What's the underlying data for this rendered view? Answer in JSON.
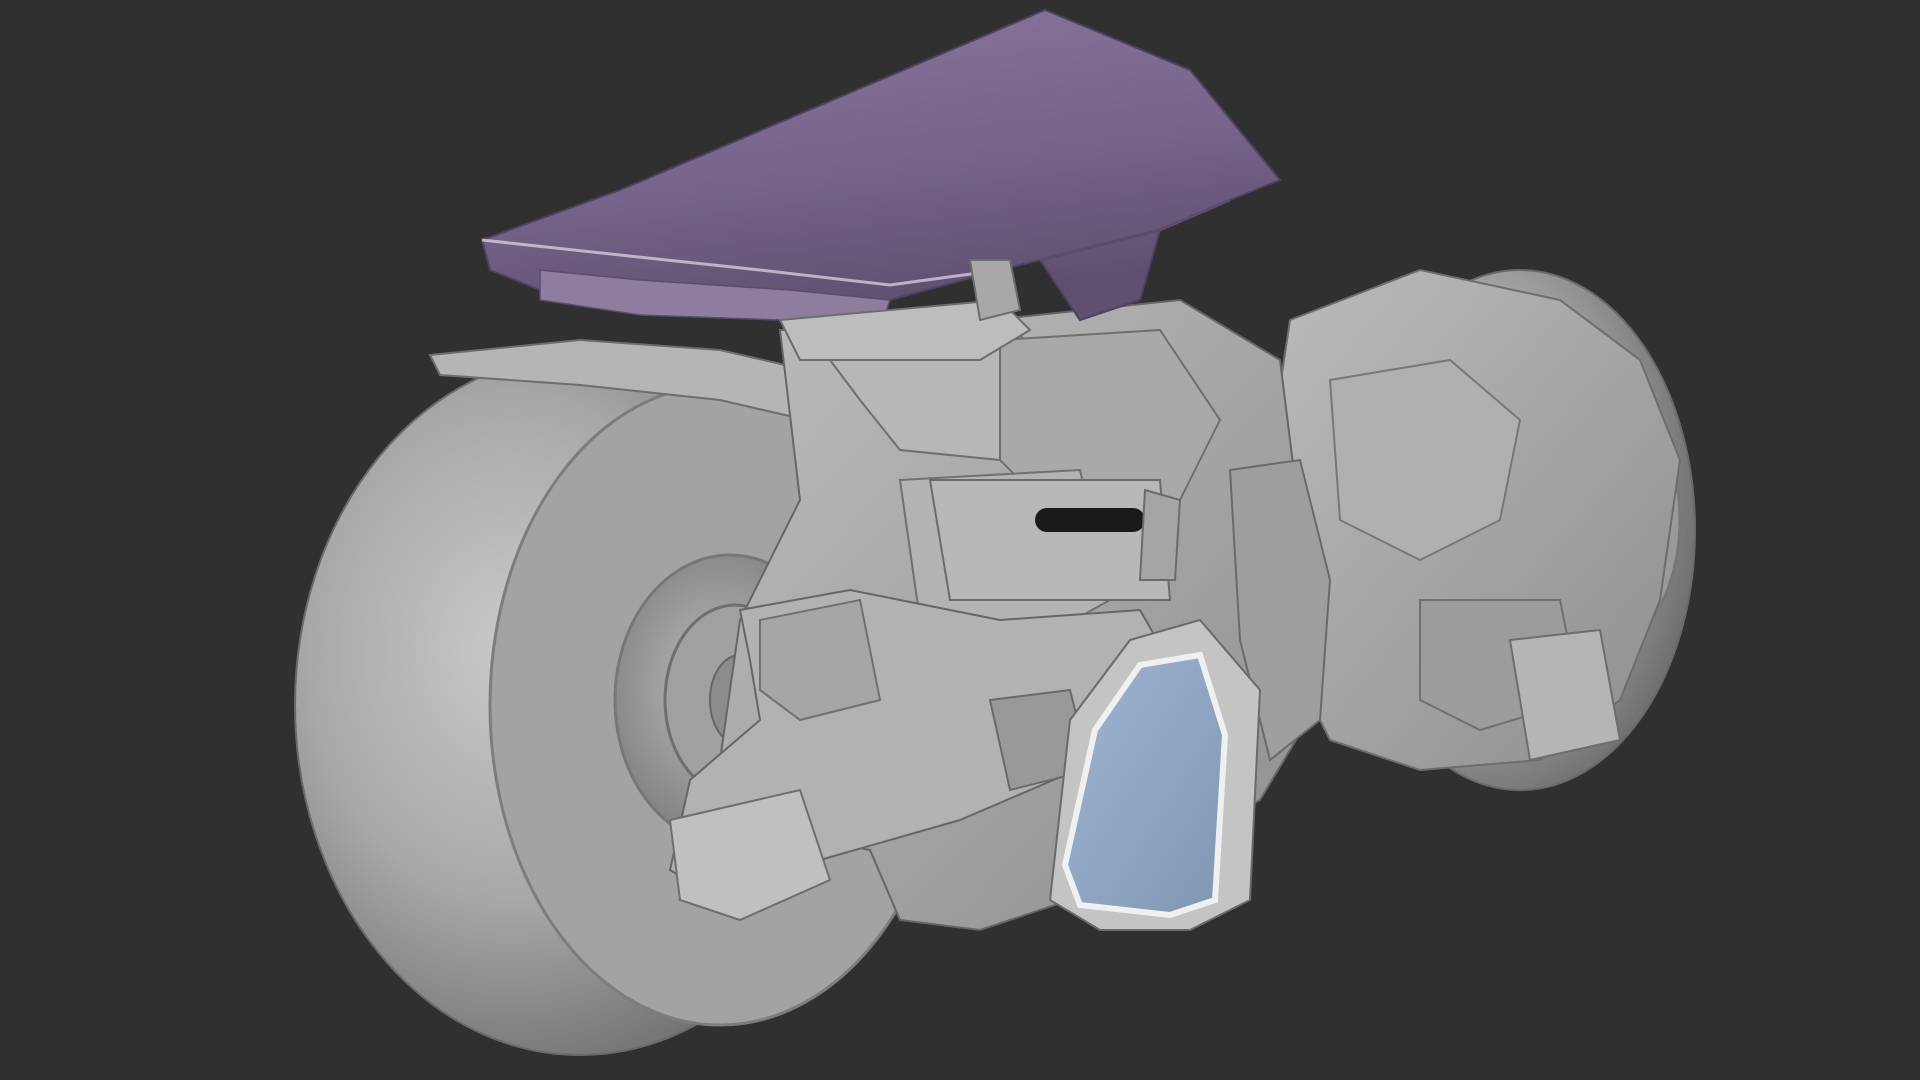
{
  "viewport": {
    "background": "#303030",
    "shading_mode": "solid",
    "model": {
      "subject": "futuristic-motorcycle",
      "body_color": "#a6a6a6",
      "seat_color": "#7d6a8c",
      "window_color": "#8ea6c2",
      "handle_grip_color": "#1a1a1a"
    }
  }
}
